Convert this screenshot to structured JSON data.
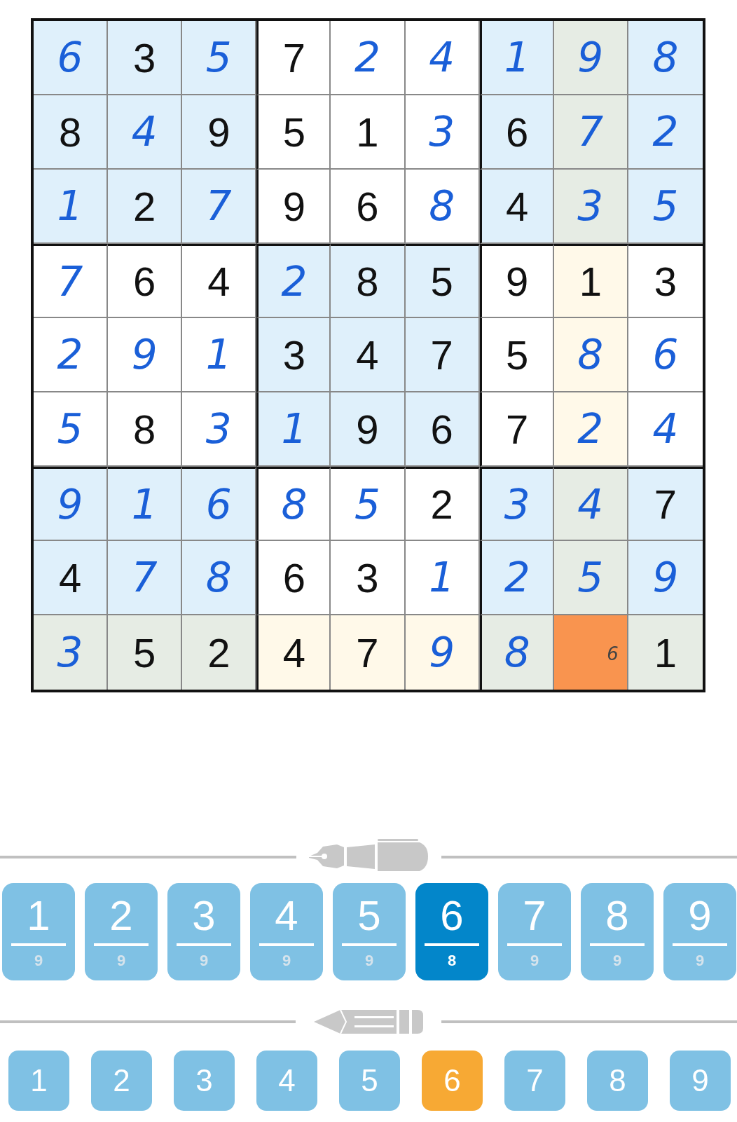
{
  "grid": {
    "rows": [
      {
        "cells": [
          {
            "value": "6",
            "given": false,
            "highlighted": false,
            "selected": false
          },
          {
            "value": "3",
            "given": true,
            "highlighted": false,
            "selected": false
          },
          {
            "value": "5",
            "given": false,
            "highlighted": false,
            "selected": false
          },
          {
            "value": "7",
            "given": true,
            "highlighted": false,
            "selected": false
          },
          {
            "value": "2",
            "given": false,
            "highlighted": false,
            "selected": false
          },
          {
            "value": "4",
            "given": false,
            "highlighted": false,
            "selected": false
          },
          {
            "value": "1",
            "given": false,
            "highlighted": false,
            "selected": false
          },
          {
            "value": "9",
            "given": false,
            "highlighted": true,
            "selected": false
          },
          {
            "value": "8",
            "given": false,
            "highlighted": false,
            "selected": false
          }
        ]
      },
      {
        "cells": [
          {
            "value": "8",
            "given": true,
            "highlighted": false,
            "selected": false
          },
          {
            "value": "4",
            "given": false,
            "highlighted": false,
            "selected": false
          },
          {
            "value": "9",
            "given": true,
            "highlighted": false,
            "selected": false
          },
          {
            "value": "5",
            "given": true,
            "highlighted": false,
            "selected": false
          },
          {
            "value": "1",
            "given": true,
            "highlighted": false,
            "selected": false
          },
          {
            "value": "3",
            "given": false,
            "highlighted": false,
            "selected": false
          },
          {
            "value": "6",
            "given": true,
            "highlighted": false,
            "selected": false
          },
          {
            "value": "7",
            "given": false,
            "highlighted": true,
            "selected": false
          },
          {
            "value": "2",
            "given": false,
            "highlighted": false,
            "selected": false
          }
        ]
      },
      {
        "cells": [
          {
            "value": "1",
            "given": false,
            "highlighted": false,
            "selected": false
          },
          {
            "value": "2",
            "given": true,
            "highlighted": false,
            "selected": false
          },
          {
            "value": "7",
            "given": false,
            "highlighted": false,
            "selected": false
          },
          {
            "value": "9",
            "given": true,
            "highlighted": false,
            "selected": false
          },
          {
            "value": "6",
            "given": true,
            "highlighted": false,
            "selected": false
          },
          {
            "value": "8",
            "given": false,
            "highlighted": false,
            "selected": false
          },
          {
            "value": "4",
            "given": true,
            "highlighted": false,
            "selected": false
          },
          {
            "value": "3",
            "given": false,
            "highlighted": true,
            "selected": false
          },
          {
            "value": "5",
            "given": false,
            "highlighted": false,
            "selected": false
          }
        ]
      },
      {
        "cells": [
          {
            "value": "7",
            "given": false,
            "highlighted": false,
            "selected": false
          },
          {
            "value": "6",
            "given": true,
            "highlighted": false,
            "selected": false
          },
          {
            "value": "4",
            "given": true,
            "highlighted": false,
            "selected": false
          },
          {
            "value": "2",
            "given": false,
            "highlighted": false,
            "selected": false
          },
          {
            "value": "8",
            "given": true,
            "highlighted": false,
            "selected": false
          },
          {
            "value": "5",
            "given": true,
            "highlighted": false,
            "selected": false
          },
          {
            "value": "9",
            "given": true,
            "highlighted": false,
            "selected": false
          },
          {
            "value": "1",
            "given": true,
            "highlighted": true,
            "selected": false
          },
          {
            "value": "3",
            "given": true,
            "highlighted": false,
            "selected": false
          }
        ]
      },
      {
        "cells": [
          {
            "value": "2",
            "given": false,
            "highlighted": false,
            "selected": false
          },
          {
            "value": "9",
            "given": false,
            "highlighted": false,
            "selected": false
          },
          {
            "value": "1",
            "given": false,
            "highlighted": false,
            "selected": false
          },
          {
            "value": "3",
            "given": true,
            "highlighted": false,
            "selected": false
          },
          {
            "value": "4",
            "given": true,
            "highlighted": false,
            "selected": false
          },
          {
            "value": "7",
            "given": true,
            "highlighted": false,
            "selected": false
          },
          {
            "value": "5",
            "given": true,
            "highlighted": false,
            "selected": false
          },
          {
            "value": "8",
            "given": false,
            "highlighted": true,
            "selected": false
          },
          {
            "value": "6",
            "given": false,
            "highlighted": false,
            "selected": false
          }
        ]
      },
      {
        "cells": [
          {
            "value": "5",
            "given": false,
            "highlighted": false,
            "selected": false
          },
          {
            "value": "8",
            "given": true,
            "highlighted": false,
            "selected": false
          },
          {
            "value": "3",
            "given": false,
            "highlighted": false,
            "selected": false
          },
          {
            "value": "1",
            "given": false,
            "highlighted": false,
            "selected": false
          },
          {
            "value": "9",
            "given": true,
            "highlighted": false,
            "selected": false
          },
          {
            "value": "6",
            "given": true,
            "highlighted": false,
            "selected": false
          },
          {
            "value": "7",
            "given": true,
            "highlighted": false,
            "selected": false
          },
          {
            "value": "2",
            "given": false,
            "highlighted": true,
            "selected": false
          },
          {
            "value": "4",
            "given": false,
            "highlighted": false,
            "selected": false
          }
        ]
      },
      {
        "cells": [
          {
            "value": "9",
            "given": false,
            "highlighted": false,
            "selected": false
          },
          {
            "value": "1",
            "given": false,
            "highlighted": false,
            "selected": false
          },
          {
            "value": "6",
            "given": false,
            "highlighted": false,
            "selected": false
          },
          {
            "value": "8",
            "given": false,
            "highlighted": false,
            "selected": false
          },
          {
            "value": "5",
            "given": false,
            "highlighted": false,
            "selected": false
          },
          {
            "value": "2",
            "given": true,
            "highlighted": false,
            "selected": false
          },
          {
            "value": "3",
            "given": false,
            "highlighted": false,
            "selected": false
          },
          {
            "value": "4",
            "given": false,
            "highlighted": true,
            "selected": false
          },
          {
            "value": "7",
            "given": true,
            "highlighted": false,
            "selected": false
          }
        ]
      },
      {
        "cells": [
          {
            "value": "4",
            "given": true,
            "highlighted": false,
            "selected": false
          },
          {
            "value": "7",
            "given": false,
            "highlighted": false,
            "selected": false
          },
          {
            "value": "8",
            "given": false,
            "highlighted": false,
            "selected": false
          },
          {
            "value": "6",
            "given": true,
            "highlighted": false,
            "selected": false
          },
          {
            "value": "3",
            "given": true,
            "highlighted": false,
            "selected": false
          },
          {
            "value": "1",
            "given": false,
            "highlighted": false,
            "selected": false
          },
          {
            "value": "2",
            "given": false,
            "highlighted": false,
            "selected": false
          },
          {
            "value": "5",
            "given": false,
            "highlighted": true,
            "selected": false
          },
          {
            "value": "9",
            "given": false,
            "highlighted": false,
            "selected": false
          }
        ]
      },
      {
        "cells": [
          {
            "value": "3",
            "given": false,
            "highlighted": true,
            "selected": false
          },
          {
            "value": "5",
            "given": true,
            "highlighted": true,
            "selected": false
          },
          {
            "value": "2",
            "given": true,
            "highlighted": true,
            "selected": false
          },
          {
            "value": "4",
            "given": true,
            "highlighted": true,
            "selected": false
          },
          {
            "value": "7",
            "given": true,
            "highlighted": true,
            "selected": false
          },
          {
            "value": "9",
            "given": false,
            "highlighted": true,
            "selected": false
          },
          {
            "value": "8",
            "given": false,
            "highlighted": true,
            "selected": false
          },
          {
            "notes": "6",
            "selected": true
          },
          {
            "value": "1",
            "given": true,
            "highlighted": true,
            "selected": false
          }
        ]
      }
    ]
  },
  "pen_keys": [
    {
      "digit": "1",
      "count": "9",
      "selected": false
    },
    {
      "digit": "2",
      "count": "9",
      "selected": false
    },
    {
      "digit": "3",
      "count": "9",
      "selected": false
    },
    {
      "digit": "4",
      "count": "9",
      "selected": false
    },
    {
      "digit": "5",
      "count": "9",
      "selected": false
    },
    {
      "digit": "6",
      "count": "8",
      "selected": true
    },
    {
      "digit": "7",
      "count": "9",
      "selected": false
    },
    {
      "digit": "8",
      "count": "9",
      "selected": false
    },
    {
      "digit": "9",
      "count": "9",
      "selected": false
    }
  ],
  "pencil_keys": [
    {
      "digit": "1",
      "selected": false
    },
    {
      "digit": "2",
      "selected": false
    },
    {
      "digit": "3",
      "selected": false
    },
    {
      "digit": "4",
      "selected": false
    },
    {
      "digit": "5",
      "selected": false
    },
    {
      "digit": "6",
      "selected": true
    },
    {
      "digit": "7",
      "selected": false
    },
    {
      "digit": "8",
      "selected": false
    },
    {
      "digit": "9",
      "selected": false
    }
  ]
}
